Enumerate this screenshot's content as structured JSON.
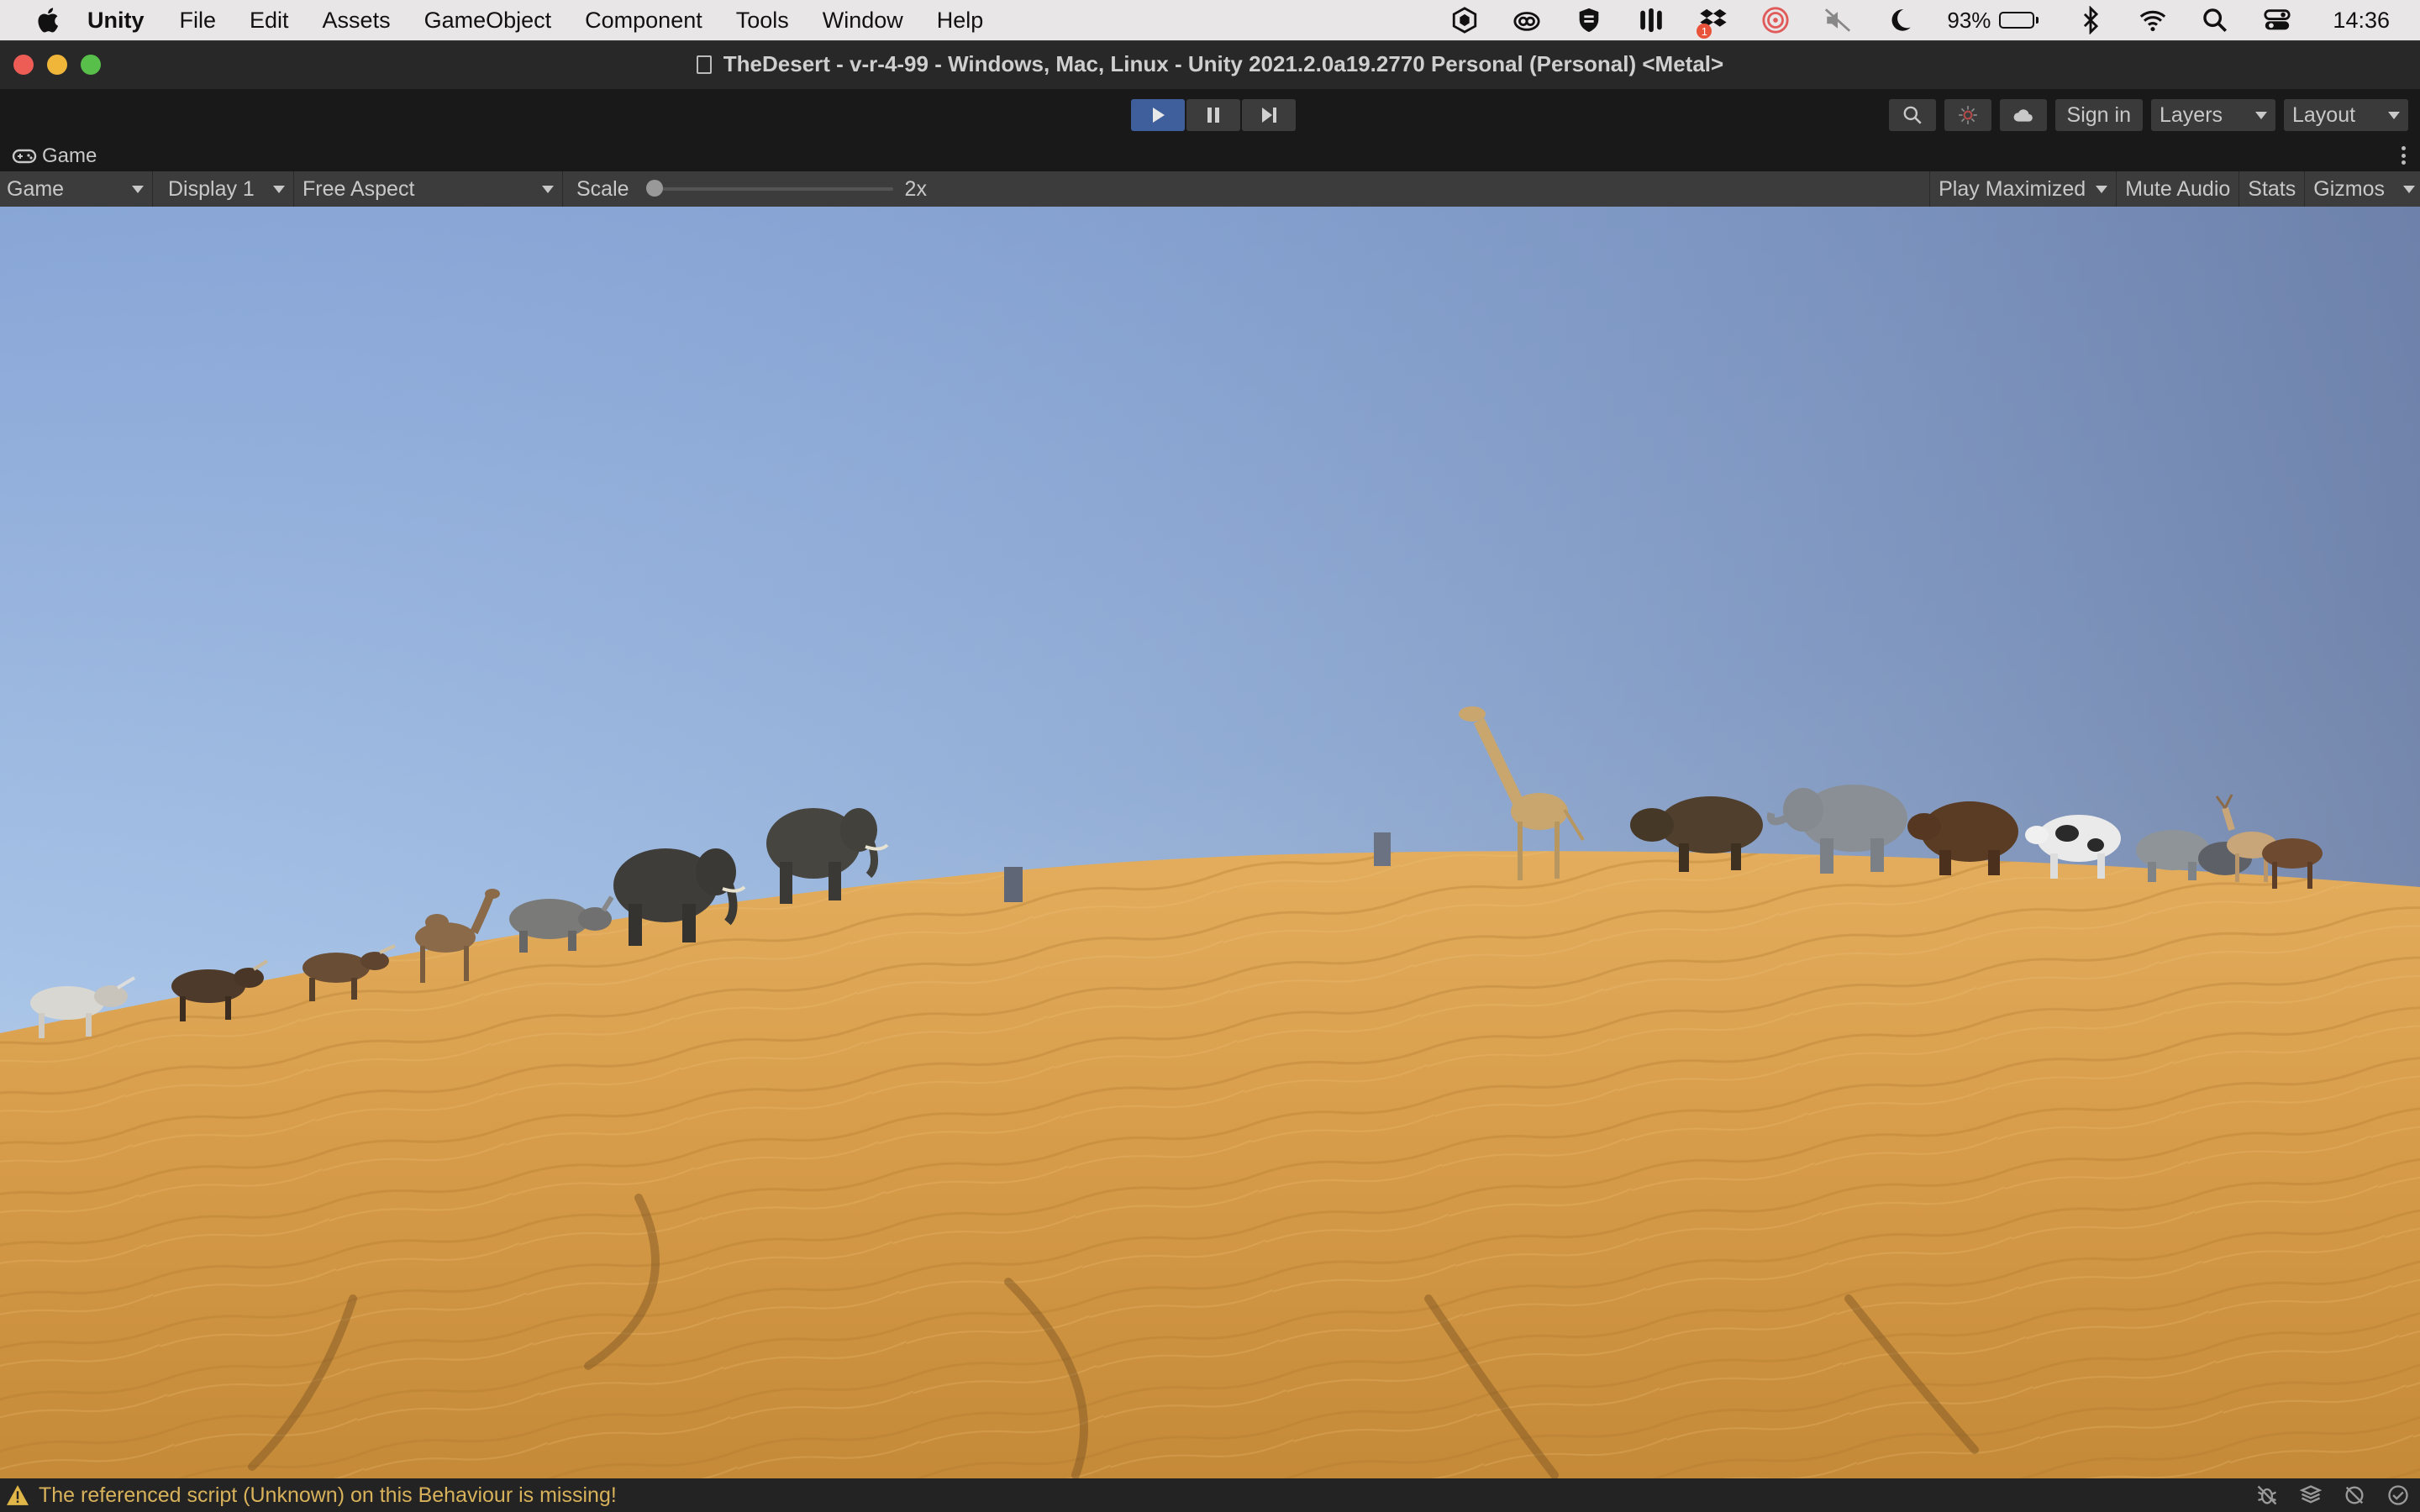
{
  "menubar": {
    "app": "Unity",
    "items": [
      "File",
      "Edit",
      "Assets",
      "GameObject",
      "Component",
      "Tools",
      "Window",
      "Help"
    ],
    "battery_percent": "93%",
    "battery_level": 0.93,
    "clock": "14:36",
    "notification_badge": "1",
    "status_icons": [
      "unity-hub-icon",
      "creative-cloud-icon",
      "app-shield-icon",
      "bars-icon",
      "dropbox-icon",
      "radar-icon",
      "muted-speaker-icon",
      "moon-icon",
      "battery-icon",
      "bluetooth-icon",
      "wifi-icon",
      "search-icon",
      "control-center-icon"
    ]
  },
  "window": {
    "title": "TheDesert - v-r-4-99 - Windows, Mac, Linux - Unity 2021.2.0a19.2770 Personal (Personal) <Metal>"
  },
  "toolbar": {
    "play_state": "playing",
    "sign_in": "Sign in",
    "layers": "Layers",
    "layout": "Layout"
  },
  "game_tab": {
    "label": "Game"
  },
  "game_bar": {
    "view_mode": "Game",
    "display": "Display 1",
    "aspect": "Free Aspect",
    "scale_label": "Scale",
    "scale_value": "2x",
    "play_maximized": "Play Maximized",
    "mute_audio": "Mute Audio",
    "stats": "Stats",
    "gizmos": "Gizmos"
  },
  "status": {
    "message": "The referenced script (Unknown) on this Behaviour is missing!"
  },
  "colors": {
    "sky_top": "#6b7fa6",
    "sky_horizon": "#c8dcf2",
    "sand_light": "#e1ad5e",
    "sand_dark": "#c48a38",
    "play_active": "#3e5e9c",
    "warning": "#d8b25a"
  }
}
